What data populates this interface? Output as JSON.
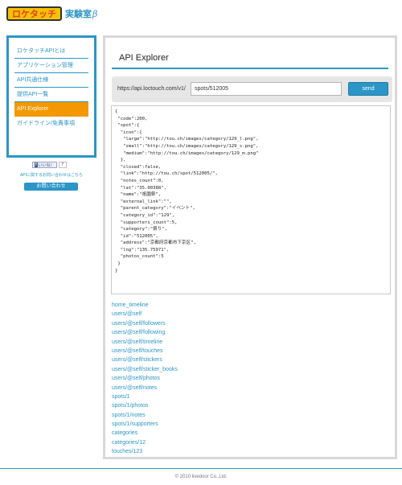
{
  "header": {
    "logo_text": "ロケタッチ",
    "logo_sub": "実験室",
    "logo_beta": "β"
  },
  "sidebar": {
    "items": [
      {
        "label": "ロケタッチAPIとは"
      },
      {
        "label": "アプリケーション管理"
      },
      {
        "label": "API共通仕様"
      },
      {
        "label": "提供API一覧"
      },
      {
        "label": "API Explorer",
        "active": true
      },
      {
        "label": "ガイドライン/免責事項"
      }
    ]
  },
  "social": {
    "like_label": "いいね！",
    "like_count": "7"
  },
  "contact": {
    "note": "APIに関するお問い合わせはこちら",
    "button_label": "お問い合わせ"
  },
  "main": {
    "title": "API Explorer",
    "base_url": "https://api.loctouch.com/v1/",
    "path_value": "spots/512005",
    "send_label": "send",
    "response": "{\n \"code\":200,\n \"spot\":{\n  \"icon\":{\n   \"large\":\"http://tou.ch/images/category/129_l.png\",\n   \"small\":\"http://tou.ch/images/category/129_s.png\",\n   \"medium\":\"http://tou.ch/images/category/129_m.png\"\n  },\n  \"closed\":false,\n  \"link\":\"http://tou.ch/spot/512005/\",\n  \"notes_count\":0,\n  \"lat\":\"35.00388\",\n  \"name\":\"祇園祭\",\n  \"external_link\":\"\",\n  \"parent_category\":\"イベント\",\n  \"category_id\":\"129\",\n  \"supporters_count\":5,\n  \"category\":\"祭り\",\n  \"id\":\"512005\",\n  \"address\":\"京都府京都市下京区\",\n  \"lng\":\"135.75971\",\n  \"photos_count\":5\n }\n}",
    "endpoints": [
      "home_timeline",
      "users/@self",
      "users/@self/followers",
      "users/@self/following",
      "users/@self/timeline",
      "users/@self/touches",
      "users/@self/stickers",
      "users/@self/sticker_books",
      "users/@self/photos",
      "users/@self/notes",
      "spots/1",
      "spots/1/photos",
      "spots/1/notes",
      "spots/1/supporters",
      "categories",
      "categories/12",
      "touches/123"
    ]
  },
  "footer": {
    "copyright": "© 2010 livedoor Co.,Ltd."
  }
}
